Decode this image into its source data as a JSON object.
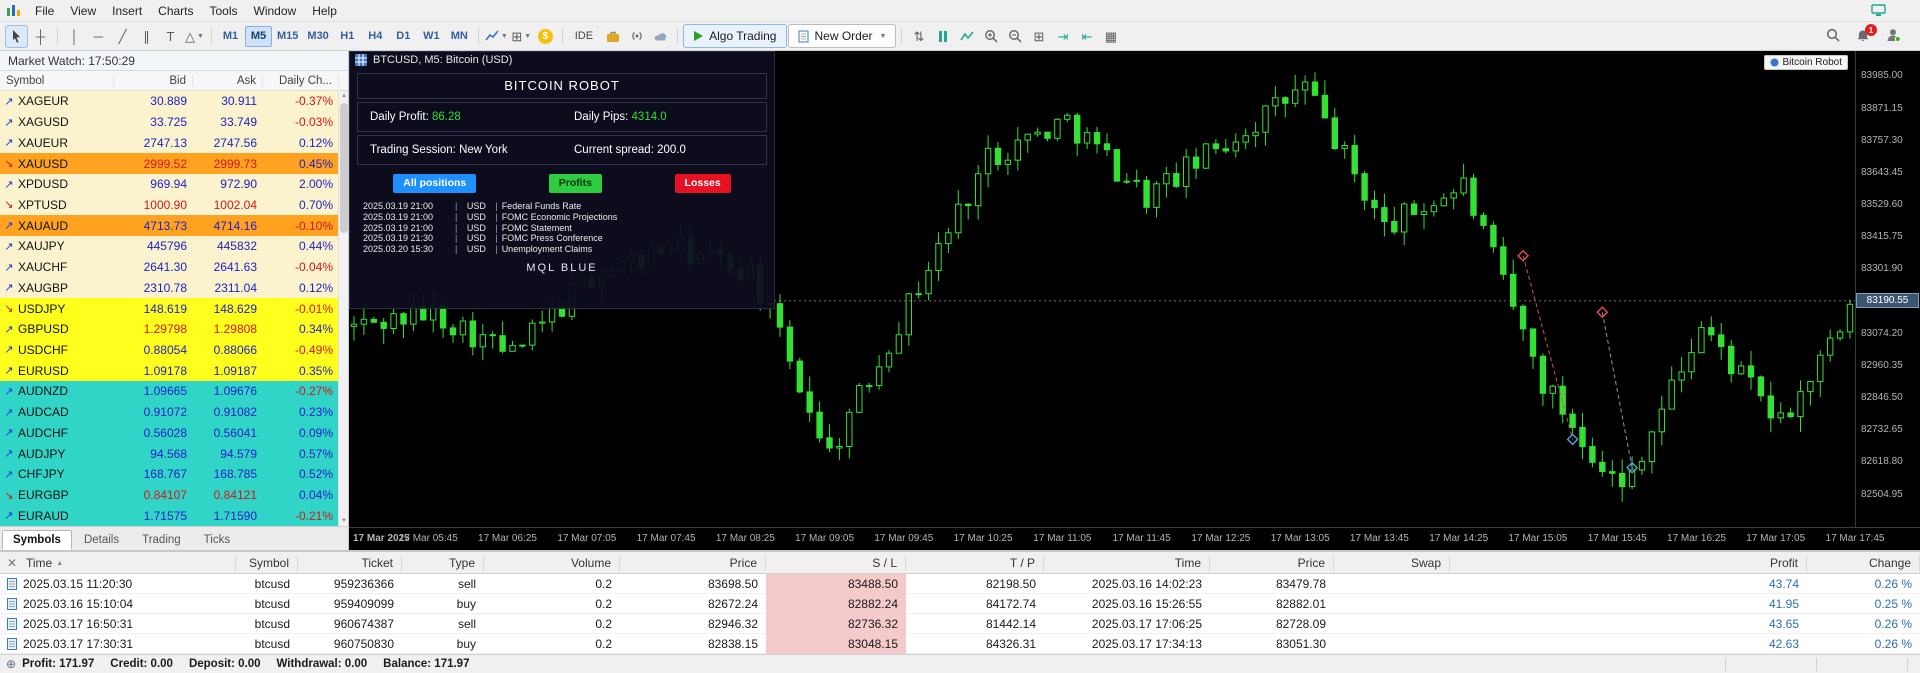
{
  "menubar": {
    "items": [
      "File",
      "View",
      "Insert",
      "Charts",
      "Tools",
      "Window",
      "Help"
    ]
  },
  "toolbar": {
    "timeframes": [
      {
        "label": "M1",
        "active": false
      },
      {
        "label": "M5",
        "active": true
      },
      {
        "label": "M15",
        "active": false
      },
      {
        "label": "M30",
        "active": false
      },
      {
        "label": "H1",
        "active": false
      },
      {
        "label": "H4",
        "active": false
      },
      {
        "label": "D1",
        "active": false
      },
      {
        "label": "W1",
        "active": false
      },
      {
        "label": "MN",
        "active": false
      }
    ],
    "ide_label": "IDE",
    "algo_trading_label": "Algo Trading",
    "new_order_label": "New Order",
    "notification_count": "1"
  },
  "market_watch": {
    "title": "Market Watch: 17:50:29",
    "columns": [
      "Symbol",
      "Bid",
      "Ask",
      "Daily Ch..."
    ],
    "rows": [
      {
        "symbol": "XAGEUR",
        "bid": "30.889",
        "ask": "30.911",
        "change": "-0.37%",
        "band": "pale",
        "dir": "up",
        "tone": "up",
        "change_tone": "down"
      },
      {
        "symbol": "XAGUSD",
        "bid": "33.725",
        "ask": "33.749",
        "change": "-0.03%",
        "band": "pale",
        "dir": "up",
        "tone": "up",
        "change_tone": "down"
      },
      {
        "symbol": "XAUEUR",
        "bid": "2747.13",
        "ask": "2747.56",
        "change": "0.12%",
        "band": "pale",
        "dir": "up",
        "tone": "up",
        "change_tone": "up"
      },
      {
        "symbol": "XAUUSD",
        "bid": "2999.52",
        "ask": "2999.73",
        "change": "0.45%",
        "band": "gold",
        "dir": "down",
        "tone": "down",
        "change_tone": "up"
      },
      {
        "symbol": "XPDUSD",
        "bid": "969.94",
        "ask": "972.90",
        "change": "2.00%",
        "band": "pale",
        "dir": "up",
        "tone": "up",
        "change_tone": "up"
      },
      {
        "symbol": "XPTUSD",
        "bid": "1000.90",
        "ask": "1002.04",
        "change": "0.70%",
        "band": "pale",
        "dir": "down",
        "tone": "down",
        "change_tone": "up"
      },
      {
        "symbol": "XAUAUD",
        "bid": "4713.73",
        "ask": "4714.16",
        "change": "-0.10%",
        "band": "gold",
        "dir": "up",
        "tone": "up",
        "change_tone": "down"
      },
      {
        "symbol": "XAUJPY",
        "bid": "445796",
        "ask": "445832",
        "change": "0.44%",
        "band": "pale",
        "dir": "up",
        "tone": "up",
        "change_tone": "up"
      },
      {
        "symbol": "XAUCHF",
        "bid": "2641.30",
        "ask": "2641.63",
        "change": "-0.04%",
        "band": "pale",
        "dir": "up",
        "tone": "up",
        "change_tone": "down"
      },
      {
        "symbol": "XAUGBP",
        "bid": "2310.78",
        "ask": "2311.04",
        "change": "0.12%",
        "band": "pale",
        "dir": "up",
        "tone": "up",
        "change_tone": "up"
      },
      {
        "symbol": "USDJPY",
        "bid": "148.619",
        "ask": "148.629",
        "change": "-0.01%",
        "band": "yellow",
        "dir": "down",
        "tone": "up",
        "change_tone": "down"
      },
      {
        "symbol": "GBPUSD",
        "bid": "1.29798",
        "ask": "1.29808",
        "change": "0.34%",
        "band": "yellow",
        "dir": "up",
        "tone": "down",
        "change_tone": "up"
      },
      {
        "symbol": "USDCHF",
        "bid": "0.88054",
        "ask": "0.88066",
        "change": "-0.49%",
        "band": "yellow",
        "dir": "up",
        "tone": "up",
        "change_tone": "down"
      },
      {
        "symbol": "EURUSD",
        "bid": "1.09178",
        "ask": "1.09187",
        "change": "0.35%",
        "band": "yellow",
        "dir": "up",
        "tone": "up",
        "change_tone": "up"
      },
      {
        "symbol": "AUDNZD",
        "bid": "1.09665",
        "ask": "1.09676",
        "change": "-0.27%",
        "band": "teal",
        "dir": "up",
        "tone": "up",
        "change_tone": "down"
      },
      {
        "symbol": "AUDCAD",
        "bid": "0.91072",
        "ask": "0.91082",
        "change": "0.23%",
        "band": "teal",
        "dir": "up",
        "tone": "up",
        "change_tone": "up"
      },
      {
        "symbol": "AUDCHF",
        "bid": "0.56028",
        "ask": "0.56041",
        "change": "0.09%",
        "band": "teal",
        "dir": "up",
        "tone": "up",
        "change_tone": "up"
      },
      {
        "symbol": "AUDJPY",
        "bid": "94.568",
        "ask": "94.579",
        "change": "0.57%",
        "band": "teal",
        "dir": "up",
        "tone": "up",
        "change_tone": "up"
      },
      {
        "symbol": "CHFJPY",
        "bid": "168.767",
        "ask": "168.785",
        "change": "0.52%",
        "band": "teal",
        "dir": "up",
        "tone": "up",
        "change_tone": "up"
      },
      {
        "symbol": "EURGBP",
        "bid": "0.84107",
        "ask": "0.84121",
        "change": "0.04%",
        "band": "teal",
        "dir": "down",
        "tone": "down",
        "change_tone": "up"
      },
      {
        "symbol": "EURAUD",
        "bid": "1.71575",
        "ask": "1.71590",
        "change": "-0.21%",
        "band": "teal",
        "dir": "up",
        "tone": "up",
        "change_tone": "down"
      }
    ],
    "tabs": [
      {
        "label": "Symbols",
        "active": true
      },
      {
        "label": "Details",
        "active": false
      },
      {
        "label": "Trading",
        "active": false
      },
      {
        "label": "Ticks",
        "active": false
      }
    ]
  },
  "chart": {
    "title": "BTCUSD, M5:  Bitcoin (USD)",
    "ea_name": "Bitcoin Robot",
    "current_price": "83190.55",
    "price_labels": [
      "83985.00",
      "83871.15",
      "83757.30",
      "83643.45",
      "83529.60",
      "83415.75",
      "83301.90",
      "83074.20",
      "82960.35",
      "82846.50",
      "82732.65",
      "82618.80",
      "82504.95"
    ],
    "time_labels": [
      "17 Mar 2025",
      "17 Mar 05:45",
      "17 Mar 06:25",
      "17 Mar 07:05",
      "17 Mar 07:45",
      "17 Mar 08:25",
      "17 Mar 09:05",
      "17 Mar 09:45",
      "17 Mar 10:25",
      "17 Mar 11:05",
      "17 Mar 11:45",
      "17 Mar 12:25",
      "17 Mar 13:05",
      "17 Mar 13:45",
      "17 Mar 14:25",
      "17 Mar 15:05",
      "17 Mar 15:45",
      "17 Mar 16:25",
      "17 Mar 17:05",
      "17 Mar 17:45"
    ],
    "robot_panel": {
      "title": "BITCOIN ROBOT",
      "daily_profit_label": "Daily Profit:",
      "daily_profit_value": "86.28",
      "daily_pips_label": "Daily Pips:",
      "daily_pips_value": "4314.0",
      "session_label": "Trading Session: New York",
      "spread_label": "Current spread: 200.0",
      "buttons": [
        {
          "label": "All positions",
          "color": "#1e90ff"
        },
        {
          "label": "Profits",
          "color": "#2ecc40"
        },
        {
          "label": "Losses",
          "color": "#e81123"
        }
      ],
      "news": [
        {
          "time": "2025.03.19 21:00",
          "currency": "USD",
          "event": "Federal Funds Rate"
        },
        {
          "time": "2025.03.19 21:00",
          "currency": "USD",
          "event": "FOMC Economic Projections"
        },
        {
          "time": "2025.03.19 21:00",
          "currency": "USD",
          "event": "FOMC Statement"
        },
        {
          "time": "2025.03.19 21:30",
          "currency": "USD",
          "event": "FOMC Press Conference"
        },
        {
          "time": "2025.03.20 15:30",
          "currency": "USD",
          "event": "Unemployment Claims"
        }
      ],
      "footer": "MQL BLUE"
    }
  },
  "chart_data": {
    "type": "candlestick",
    "symbol": "BTCUSD",
    "timeframe": "M5",
    "ylim": [
      82390,
      84075
    ],
    "anchor_prices": [
      83100,
      83150,
      83000,
      83280,
      83380,
      83300,
      82650,
      83180,
      83700,
      83830,
      83560,
      83750,
      83950,
      83450,
      83600,
      82900,
      82520,
      83100,
      82750,
      83190
    ],
    "candles_per_anchor": 8,
    "candle_color": "#35e035",
    "current_price": 83190.55,
    "markers": [
      {
        "index": 118,
        "price": 83350,
        "color": "#e05050"
      },
      {
        "index": 123,
        "price": 82700,
        "color": "#4aa3e0"
      },
      {
        "index": 126,
        "price": 83150,
        "color": "#e05050"
      },
      {
        "index": 129,
        "price": 82600,
        "color": "#4aa3e0"
      }
    ],
    "trade_lines": [
      {
        "from": [
          118,
          83350
        ],
        "to": [
          123,
          82700
        ],
        "color": "#cc5555"
      },
      {
        "from": [
          126,
          83150
        ],
        "to": [
          129,
          82600
        ],
        "color": "#8899aa"
      }
    ]
  },
  "history": {
    "columns": [
      "Time",
      "Symbol",
      "Ticket",
      "Type",
      "Volume",
      "Price",
      "S / L",
      "T / P",
      "Time",
      "Price",
      "Swap",
      "Profit",
      "Change"
    ],
    "rows": [
      {
        "open_time": "2025.03.15 11:20:30",
        "symbol": "btcusd",
        "ticket": "959236366",
        "type": "sell",
        "volume": "0.2",
        "price": "83698.50",
        "sl": "83488.50",
        "tp": "82198.50",
        "close_time": "2025.03.16 14:02:23",
        "close_price": "83479.78",
        "swap": "",
        "profit": "43.74",
        "change": "0.26 %"
      },
      {
        "open_time": "2025.03.16 15:10:04",
        "symbol": "btcusd",
        "ticket": "959409099",
        "type": "buy",
        "volume": "0.2",
        "price": "82672.24",
        "sl": "82882.24",
        "tp": "84172.74",
        "close_time": "2025.03.16 15:26:55",
        "close_price": "82882.01",
        "swap": "",
        "profit": "41.95",
        "change": "0.25 %"
      },
      {
        "open_time": "2025.03.17 16:50:31",
        "symbol": "btcusd",
        "ticket": "960674387",
        "type": "sell",
        "volume": "0.2",
        "price": "82946.32",
        "sl": "82736.32",
        "tp": "81442.14",
        "close_time": "2025.03.17 17:06:25",
        "close_price": "82728.09",
        "swap": "",
        "profit": "43.65",
        "change": "0.26 %"
      },
      {
        "open_time": "2025.03.17 17:30:31",
        "symbol": "btcusd",
        "ticket": "960750830",
        "type": "buy",
        "volume": "0.2",
        "price": "82838.15",
        "sl": "83048.15",
        "tp": "84326.31",
        "close_time": "2025.03.17 17:34:13",
        "close_price": "83051.30",
        "swap": "",
        "profit": "42.63",
        "change": "0.26 %"
      }
    ]
  },
  "status_bar": {
    "items": [
      "Profit: 171.97",
      "Credit: 0.00",
      "Deposit: 0.00",
      "Withdrawal: 0.00",
      "Balance: 171.97"
    ]
  }
}
